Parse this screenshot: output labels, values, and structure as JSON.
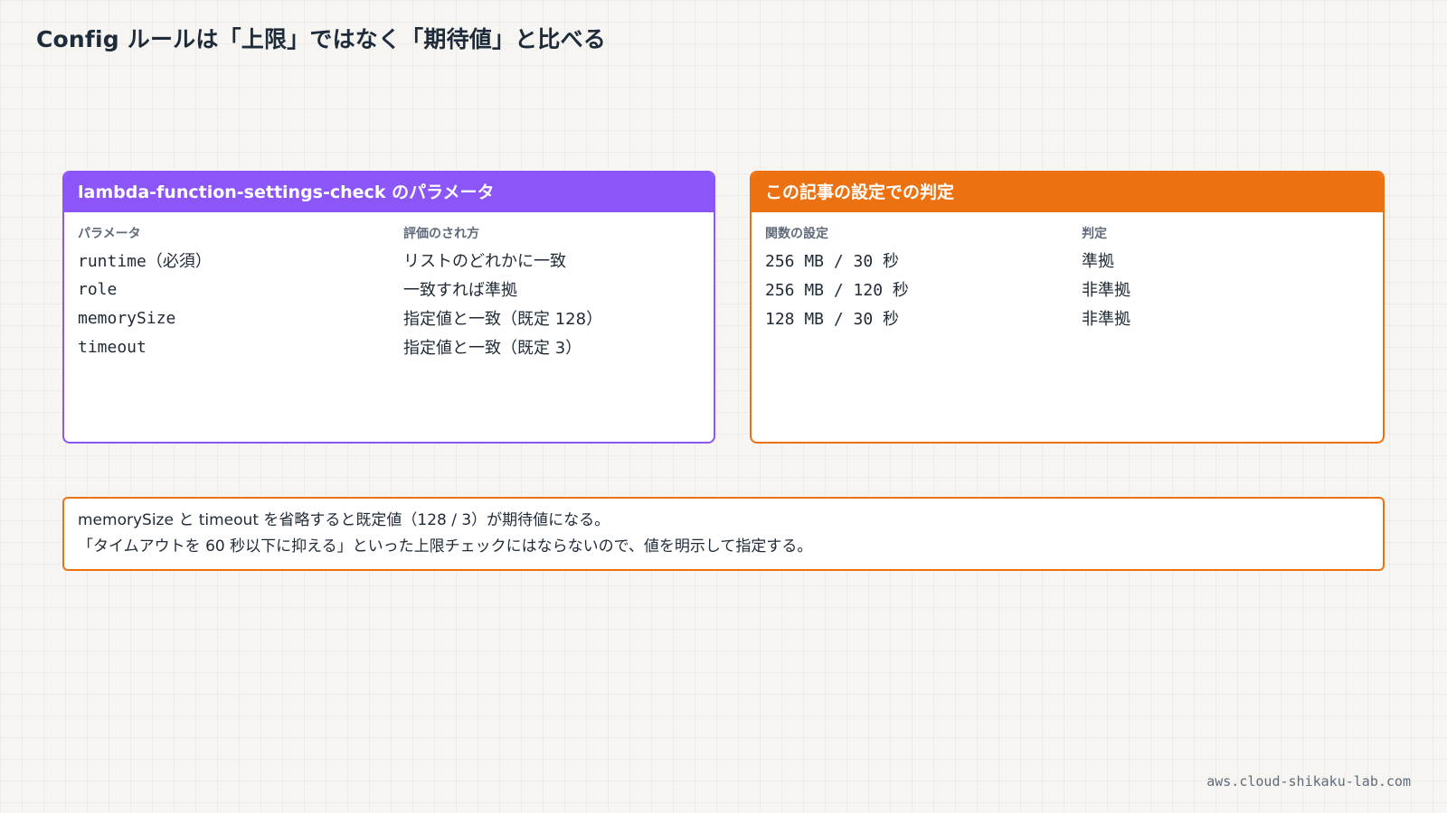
{
  "page": {
    "title": "Config ルールは「上限」ではなく「期待値」と比べる"
  },
  "parameters_card": {
    "header": "lambda-function-settings-check のパラメータ",
    "columns": [
      "パラメータ",
      "評価のされ方"
    ],
    "rows": [
      {
        "name": "runtime",
        "suffix": "（必須）",
        "evaluation": "リストのどれかに一致"
      },
      {
        "name": "role",
        "suffix": "",
        "evaluation": "一致すれば準拠"
      },
      {
        "name": "memorySize",
        "suffix": "",
        "evaluation": "指定値と一致（既定 128）"
      },
      {
        "name": "timeout",
        "suffix": "",
        "evaluation": "指定値と一致（既定 3）"
      }
    ]
  },
  "judgement_card": {
    "header": "この記事の設定での判定",
    "columns": [
      "関数の設定",
      "判定"
    ],
    "rows": [
      {
        "setting": "256 MB / 30 秒",
        "result": "準拠"
      },
      {
        "setting": "256 MB / 120 秒",
        "result": "非準拠"
      },
      {
        "setting": "128 MB / 30 秒",
        "result": "非準拠"
      }
    ]
  },
  "note": {
    "line1": "memorySize と timeout を省略すると既定値（128 / 3）が期待値になる。",
    "line2": "「タイムアウトを 60 秒以下に抑える」といった上限チェックにはならないので、値を明示して指定する。"
  },
  "footer": {
    "site": "aws.cloud-shikaku-lab.com"
  },
  "colors": {
    "background": "#f6f5f1",
    "purple_accent": "#8b55f7",
    "orange_accent": "#ec7211",
    "text": "#1f2a37",
    "muted": "#5f6b7a"
  }
}
